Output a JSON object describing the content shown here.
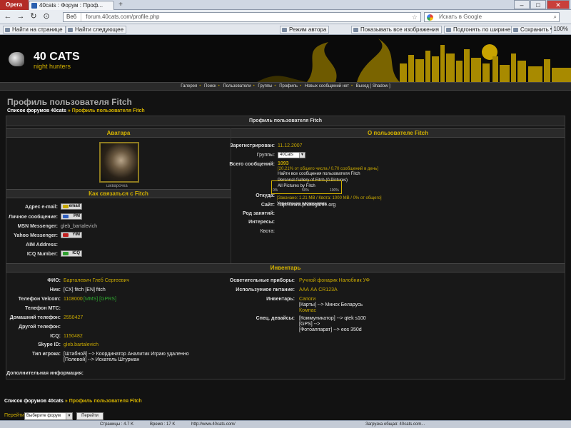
{
  "browser": {
    "menu_label": "Opera",
    "tab_title": "40cats : Форум : Проф...",
    "new_tab": "+",
    "win_min": "–",
    "win_max": "□",
    "win_close": "✕",
    "back": "←",
    "forward": "→",
    "reload": "↻",
    "speed": "⊙",
    "url_prefix": "Веб",
    "url": "forum.40cats.com/profile.php",
    "star": "☆",
    "search_placeholder": "Искать в Google",
    "search_go": "⌕"
  },
  "toolbar": {
    "find": "Найти на странице",
    "find_next": "Найти следующее",
    "author_mode": "Режим автора",
    "show_images": "Показывать все изображения",
    "fit_width": "Подгонять по ширине",
    "save": "Сохранить",
    "zoom": "• 100%"
  },
  "site": {
    "logo_main": "40 CATS",
    "logo_sub": "night hunters",
    "nav": [
      "Галерея",
      "Поиск",
      "Пользователи",
      "Группы",
      "Профиль",
      "Новых сообщений нет",
      "Выход [ Shadow ]"
    ]
  },
  "page": {
    "title": "Профиль пользователя Fitch",
    "crumb_home": "Список форумов 40cats",
    "crumb_sep": " » ",
    "crumb_current": "Профиль пользователя Fitch",
    "frame_title": "Профиль пользователя Fitch"
  },
  "avatar_section": {
    "title": "Аватара",
    "caption": "шкварочка"
  },
  "contact": {
    "title": "Как связаться с Fitch",
    "email_label": "Адрес e-mail:",
    "email_btn": "email",
    "pm_label": "Личное сообщение:",
    "pm_btn": "PM",
    "msn_label": "MSN Messenger:",
    "msn_value": "gleb_bartalevich",
    "yahoo_label": "Yahoo Messenger:",
    "yahoo_btn": "YIM",
    "aim_label": "AIM Address:",
    "icq_label": "ICQ Number:",
    "icq_btn": "ICQ"
  },
  "about": {
    "title": "О пользователе Fitch",
    "registered_label": "Зарегистрирован:",
    "registered_value": "11.12.2007",
    "groups_label": "Группы:",
    "groups_value": "40Cats",
    "posts_label": "Всего сообщений:",
    "posts_value": "1093",
    "posts_pct": "[20.21% от общего числа / 0.70 сообщений в день]",
    "posts_find": "Найти все сообщения пользователя Fitch",
    "gallery": "Personal Gallery of Fitch (0 Pictures)",
    "all_pictures": "All Pictures by Fitch",
    "from_label": "Откуда:",
    "site_label": "Сайт:",
    "site_value": "http://www.photogame.org",
    "occupation_label": "Род занятий:",
    "interests_label": "Интересы:",
    "quota_label": "Квота:",
    "quota_ticks": [
      "0%",
      "50%",
      "100%"
    ],
    "quota_used": 0,
    "quota_summary": "[Закачано: 1.21 MB / Квота: 1000 MB / 0% от общего]",
    "attachments": "Управление вложениями"
  },
  "inventory": {
    "title": "Инвентарь",
    "fio_label": "ФИО:",
    "fio_value": "Барталевич Глеб Сергеевич",
    "nick_label": "Ник:",
    "nick_value": "[CX] fitch   [EN] fitch",
    "velcom_label": "Телефон Velcom:",
    "velcom_value": "1108000",
    "velcom_tags": "[MMS] [GPRS]",
    "mts_label": "Телефон МТС:",
    "home_label": "Домашний телефон:",
    "home_value": "2550427",
    "other_label": "Другой телефон:",
    "icq_label": "ICQ:",
    "icq_value": "1150482",
    "skype_label": "Skype ID:",
    "skype_value": "gleb.bartalevich",
    "type_label": "Тип игрока:",
    "type_line1": "[Штабной]  -->  Координатор    Аналитик    Играю удаленно",
    "type_line2": "[Полевой]  -->  Искатель    Штурман",
    "extra_label": "Дополнительная информация:",
    "lights_label": "Осветительные приборы:",
    "lights_value": "Ручной фонарик    Налобник    УФ",
    "power_label": "Используемое питание:",
    "power_value": "ААА    АА    CR123A",
    "inv_label": "Инвентарь:",
    "inv_line1": "Сапоги",
    "inv_line2": "[Карты]  -->  Минск    Беларусь",
    "inv_line3": "Компас",
    "dev_label": "Спец. девайсы:",
    "dev_line1": "[Коммуникатор]  -->  qtek s100",
    "dev_line2": "[GPS]  -->",
    "dev_line3": "[Фотоаппарат]  -->  eos 350d"
  },
  "footer": {
    "crumb_home": "Список форумов 40cats",
    "crumb_sep": " » ",
    "crumb_current": "Профиль пользователя Fitch",
    "jump_label": "Перейти:",
    "jump_select": "Выберите форум",
    "jump_button": "Перейти"
  },
  "statusbar": {
    "s1": "Страницы : 4.7 K",
    "s2": "Время : 17 K",
    "s3": "http://www.40cats.com/",
    "s4": "Загрузка общая: 40cats.com..."
  }
}
